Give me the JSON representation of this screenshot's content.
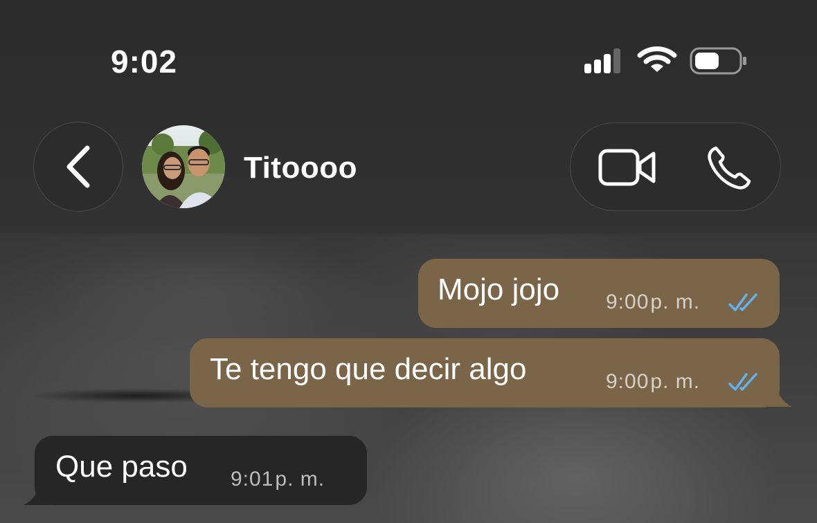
{
  "status_bar": {
    "time": "9:02",
    "signal_icon": "cellular-signal-icon",
    "wifi_icon": "wifi-icon",
    "battery_icon": "battery-icon"
  },
  "header": {
    "back_icon": "chevron-left-icon",
    "contact_name": "Titoooo",
    "video_icon": "video-camera-icon",
    "phone_icon": "phone-icon"
  },
  "messages": [
    {
      "direction": "out",
      "text": "Mojo jojo",
      "time": "9:00",
      "ampm": "p. m.",
      "status": "read"
    },
    {
      "direction": "out",
      "text": "Te tengo que decir algo",
      "time": "9:00",
      "ampm": "p. m.",
      "status": "read"
    },
    {
      "direction": "in",
      "text": "Que paso",
      "time": "9:01",
      "ampm": "p. m."
    }
  ],
  "colors": {
    "outgoing_bubble": "#7a6549",
    "incoming_bubble": "#262626",
    "read_ticks": "#5fb3f0"
  }
}
